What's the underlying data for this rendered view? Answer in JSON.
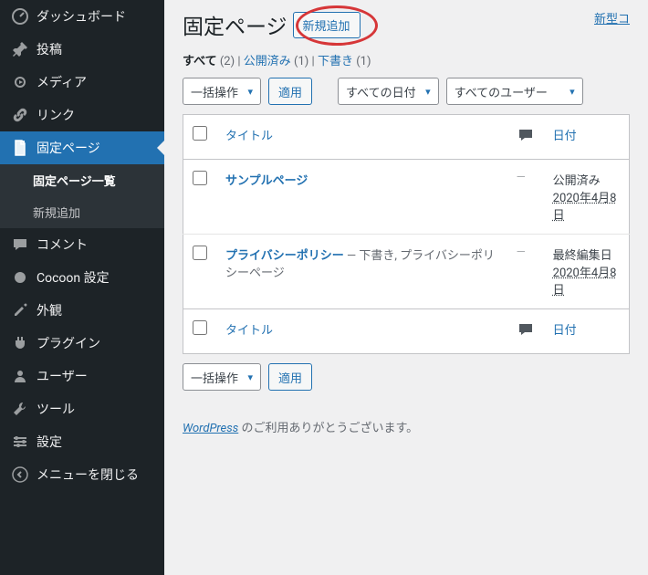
{
  "sidebar": {
    "items": [
      {
        "label": "ダッシュボード",
        "icon": "dashboard-icon"
      },
      {
        "label": "投稿",
        "icon": "pin-icon"
      },
      {
        "label": "メディア",
        "icon": "media-icon"
      },
      {
        "label": "リンク",
        "icon": "link-icon"
      },
      {
        "label": "固定ページ",
        "icon": "page-icon",
        "current": true
      },
      {
        "label": "コメント",
        "icon": "comment-icon"
      },
      {
        "label": "Cocoon 設定",
        "icon": "cocoon-icon"
      },
      {
        "label": "外観",
        "icon": "appearance-icon"
      },
      {
        "label": "プラグイン",
        "icon": "plugin-icon"
      },
      {
        "label": "ユーザー",
        "icon": "user-icon"
      },
      {
        "label": "ツール",
        "icon": "tool-icon"
      },
      {
        "label": "設定",
        "icon": "settings-icon"
      },
      {
        "label": "メニューを閉じる",
        "icon": "collapse-icon"
      }
    ],
    "submenu": [
      {
        "label": "固定ページ一覧",
        "active": true
      },
      {
        "label": "新規追加"
      }
    ]
  },
  "header": {
    "title": "固定ページ",
    "add_new": "新規追加",
    "notice": "新型コ"
  },
  "filters": {
    "all_label": "すべて",
    "all_count": "(2)",
    "published_label": "公開済み",
    "published_count": "(1)",
    "draft_label": "下書き",
    "draft_count": "(1)",
    "sep": " | "
  },
  "bulk": {
    "action_label": "一括操作",
    "apply": "適用",
    "date_filter": "すべての日付",
    "user_filter": "すべてのユーザー"
  },
  "table": {
    "col_title": "タイトル",
    "col_date": "日付",
    "rows": [
      {
        "title": "サンプルページ",
        "states": "",
        "comment": "—",
        "date_status": "公開済み",
        "date_value": "2020年4月8日"
      },
      {
        "title": "プライバシーポリシー",
        "states": " — 下書き, プライバシーポリシーページ",
        "comment": "—",
        "date_status": "最終編集日",
        "date_value": "2020年4月8日"
      }
    ]
  },
  "footer": {
    "wp_link": "WordPress",
    "thanks": " のご利用ありがとうございます。"
  }
}
